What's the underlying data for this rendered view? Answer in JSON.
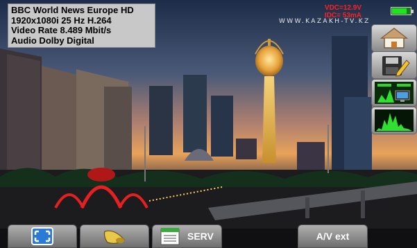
{
  "channel_info": {
    "line1": "BBC World News Europe HD",
    "line2": "1920x1080i 25 Hz H.264",
    "line3": "Video Rate 8.489 Mbit/s",
    "line4": "Audio Dolby Digital"
  },
  "watermark": "WWW.KAZAKH-TV.KZ",
  "power": {
    "vdc": "VDC=12.9V",
    "idc": "IDC= 53mA",
    "battery_level": 0.8,
    "battery_color": "#22e022"
  },
  "side_buttons": {
    "home_icon": "home-icon",
    "save_icon": "save-icon",
    "signal_monitor_icon": "signal-monitor-icon",
    "spectrum_icon": "spectrum-icon"
  },
  "bottom_bar": {
    "fullscreen_icon": "fullscreen-icon",
    "audio_icon": "speaker-icon",
    "serv_icon": "service-list-icon",
    "serv_label": "SERV",
    "av_label": "A/V ext"
  }
}
